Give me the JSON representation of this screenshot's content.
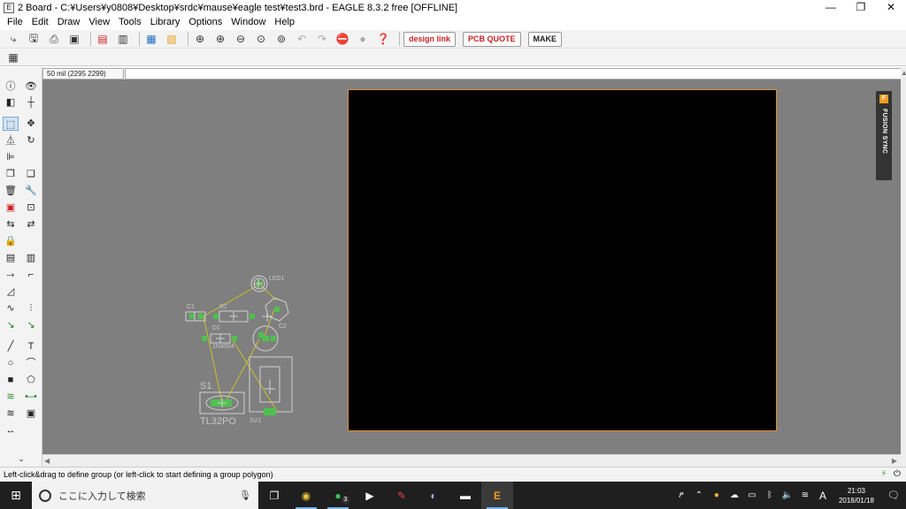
{
  "window": {
    "title": "2 Board - C:¥Users¥y0808¥Desktop¥srdc¥mause¥eagle test¥test3.brd - EAGLE 8.3.2 free [OFFLINE]",
    "minimize": "—",
    "maximize": "❐",
    "close": "✕"
  },
  "menu": [
    "File",
    "Edit",
    "Draw",
    "View",
    "Tools",
    "Library",
    "Options",
    "Window",
    "Help"
  ],
  "toolbar": {
    "design_link": "design link",
    "pcb_quote": "PCB QUOTE",
    "make": "MAKE"
  },
  "command_bar": {
    "coordinates": "50 mil (2295 2299)",
    "command_value": ""
  },
  "canvas": {
    "components": {
      "led1": "LED1",
      "c1": "C1",
      "r1": "R1",
      "d1": "D1",
      "c2": "C2",
      "diode": "1N4004",
      "s1": "S1",
      "switch": "TL32PO",
      "sv": "SV1"
    },
    "board_outline_color": "#d98f2b",
    "board_fill_color": "#000000",
    "background_color": "#7f7f7f"
  },
  "fusion": {
    "label": "FUSION SYNC"
  },
  "status": {
    "text": "Left-click&drag to define group (or left-click to start defining a group polygon)"
  },
  "taskbar": {
    "search_placeholder": "ここに入力して検索",
    "line_badge": "3",
    "ime": "A",
    "time": "21:03",
    "date": "2018/01/18"
  }
}
